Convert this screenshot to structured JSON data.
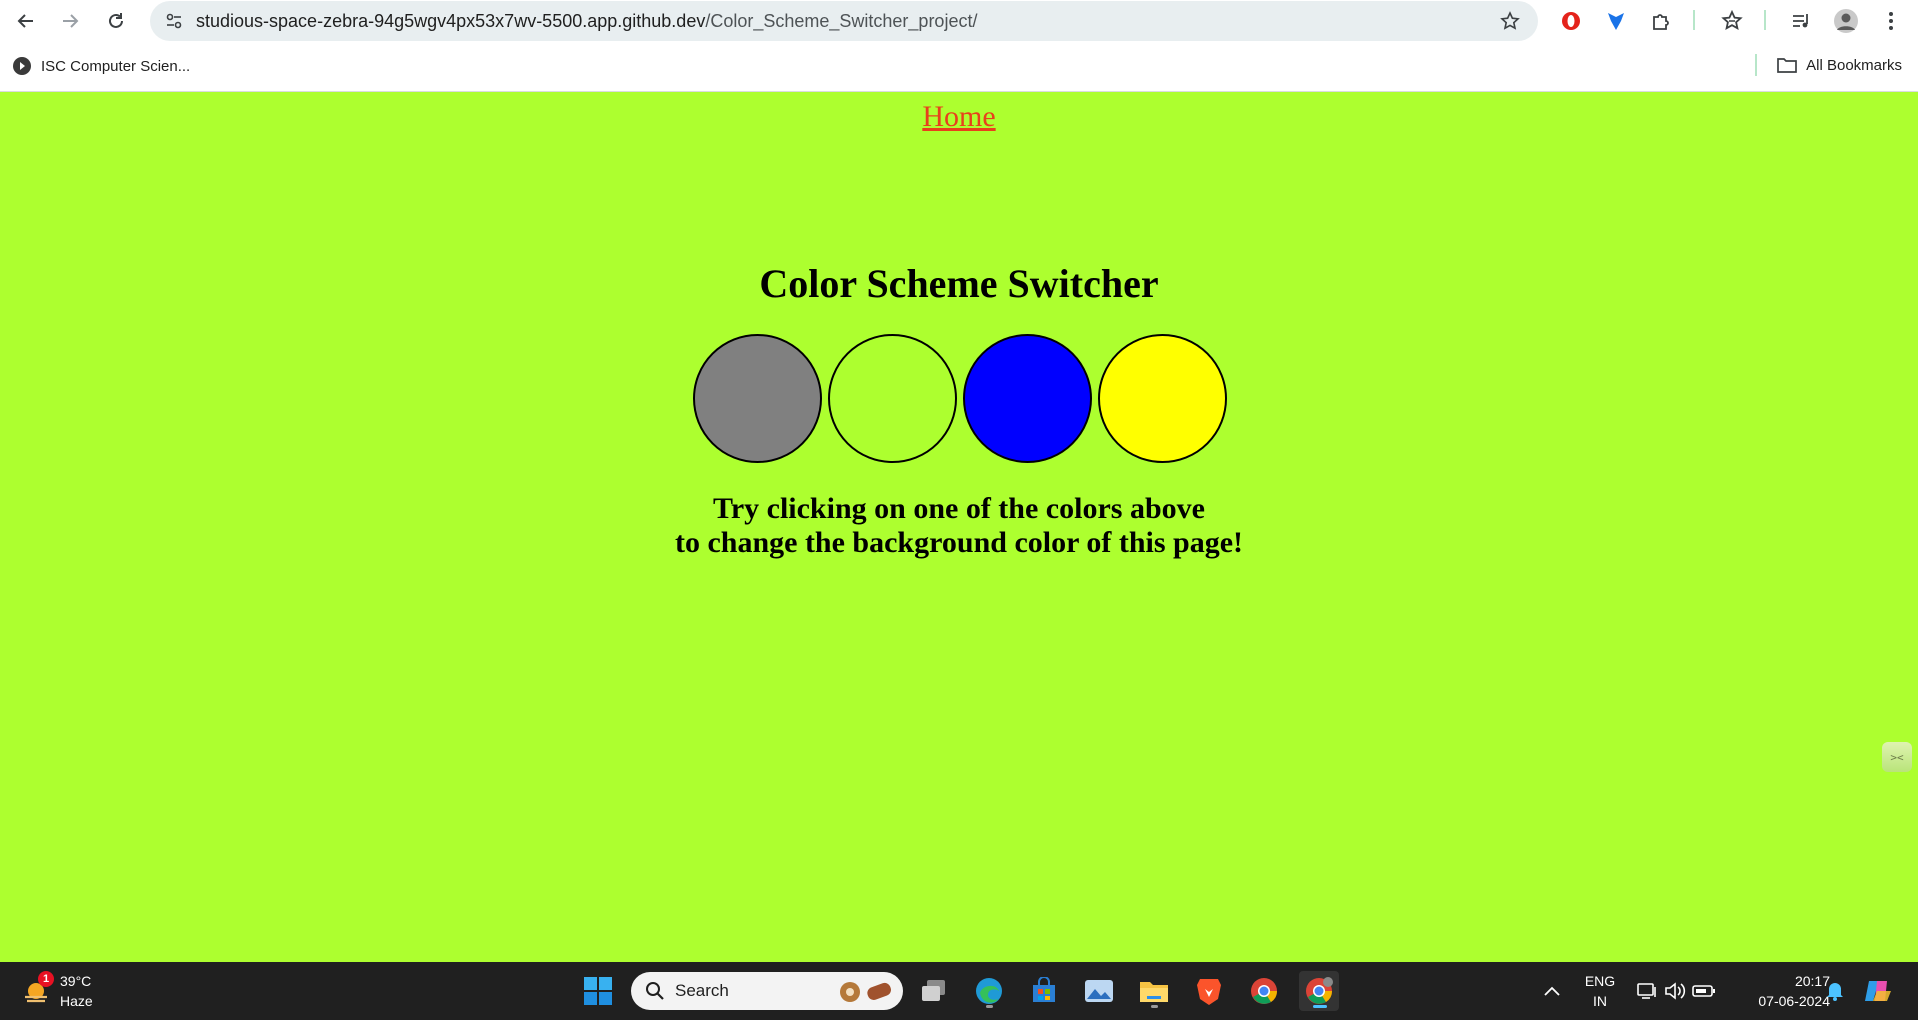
{
  "browser": {
    "url_host": "studious-space-zebra-94g5wgv4px53x7wv-5500.app.github.dev",
    "url_path": "/Color_Scheme_Switcher_project/",
    "bookmarks": [
      {
        "label": "ISC Computer Scien..."
      }
    ],
    "all_bookmarks_label": "All Bookmarks"
  },
  "page": {
    "home_link": "Home",
    "title": "Color Scheme Switcher",
    "background_color": "#adff2f",
    "swatches": [
      {
        "color": "#808080",
        "name": "grey"
      },
      {
        "color": "#adff2f",
        "name": "greenyellow"
      },
      {
        "color": "#0000ff",
        "name": "blue"
      },
      {
        "color": "#ffff00",
        "name": "yellow"
      }
    ],
    "hint_line1": "Try clicking on one of the colors above",
    "hint_line2": "to change the background color of this page!"
  },
  "taskbar": {
    "weather_temp": "39°C",
    "weather_desc": "Haze",
    "weather_badge": "1",
    "search_label": "Search",
    "language_line1": "ENG",
    "language_line2": "IN",
    "time": "20:17",
    "date": "07-06-2024"
  }
}
